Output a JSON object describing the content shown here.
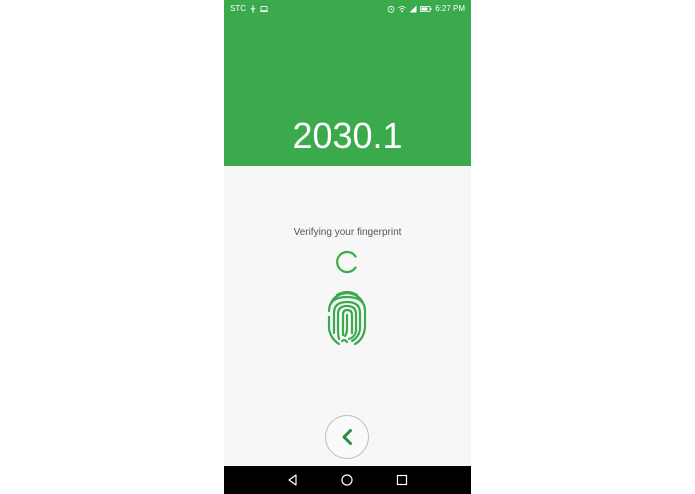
{
  "status_bar": {
    "carrier": "STC",
    "time": "6:27 PM",
    "icons_left": [
      "usb-icon",
      "screen-icon"
    ],
    "icons_right": [
      "alarm-icon",
      "wifi-icon",
      "signal-icon",
      "battery-icon"
    ]
  },
  "header": {
    "amount": "2030.1",
    "background_color": "#3aaa4c"
  },
  "verification": {
    "message": "Verifying your fingerprint",
    "accent_color": "#3aaa4c"
  },
  "back_button": {
    "icon": "chevron-left-icon"
  },
  "nav_bar": {
    "buttons": [
      "back-triangle-icon",
      "home-circle-icon",
      "recents-square-icon"
    ]
  }
}
